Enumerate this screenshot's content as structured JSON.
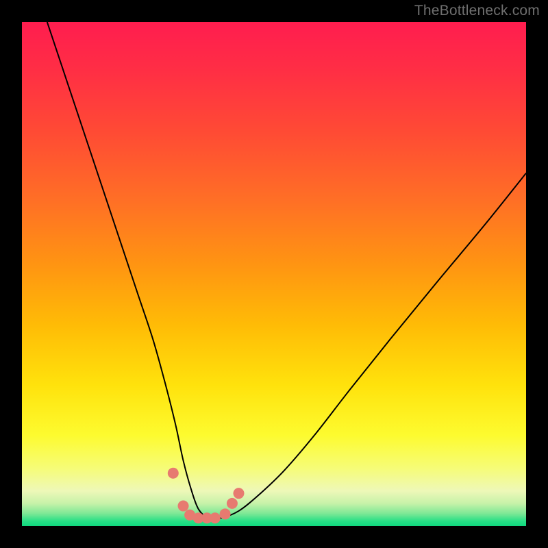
{
  "watermark": "TheBottleneck.com",
  "colors": {
    "frame": "#000000",
    "watermark": "#6f6f6f",
    "curve": "#000000",
    "marker_fill": "#e77a70",
    "marker_stroke": "#b24a42",
    "gradient_stops": [
      {
        "offset": 0.0,
        "color": "#ff1d4f"
      },
      {
        "offset": 0.1,
        "color": "#ff2f44"
      },
      {
        "offset": 0.22,
        "color": "#ff4b34"
      },
      {
        "offset": 0.35,
        "color": "#ff6e26"
      },
      {
        "offset": 0.48,
        "color": "#ff9412"
      },
      {
        "offset": 0.6,
        "color": "#ffbb06"
      },
      {
        "offset": 0.72,
        "color": "#ffe20c"
      },
      {
        "offset": 0.82,
        "color": "#fdfb2f"
      },
      {
        "offset": 0.885,
        "color": "#f6fc77"
      },
      {
        "offset": 0.93,
        "color": "#eef8b8"
      },
      {
        "offset": 0.955,
        "color": "#c7f2a9"
      },
      {
        "offset": 0.975,
        "color": "#7ee896"
      },
      {
        "offset": 0.99,
        "color": "#28df86"
      },
      {
        "offset": 1.0,
        "color": "#0fd97f"
      }
    ]
  },
  "chart_data": {
    "type": "line",
    "title": "",
    "xlabel": "",
    "ylabel": "",
    "xlim": [
      0,
      100
    ],
    "ylim": [
      0,
      100
    ],
    "grid": false,
    "legend": false,
    "series": [
      {
        "name": "bottleneck-curve",
        "x": [
          5,
          8,
          11,
          14,
          17,
          20,
          23,
          26,
          28.5,
          30.5,
          32,
          33.5,
          35,
          37,
          39.5,
          43,
          47,
          52,
          58,
          65,
          73,
          82,
          92,
          100
        ],
        "y": [
          100,
          91,
          82,
          73,
          64,
          55,
          46,
          37,
          28,
          20,
          13,
          7.5,
          3.4,
          1.6,
          1.6,
          3.0,
          6.2,
          11,
          18,
          27,
          37,
          48,
          60,
          70
        ]
      }
    ],
    "markers": {
      "name": "bottleneck-markers",
      "x": [
        30.0,
        32.0,
        33.3,
        35.0,
        36.7,
        38.3,
        40.3,
        41.7,
        43.0
      ],
      "y": [
        10.5,
        4.0,
        2.2,
        1.6,
        1.6,
        1.6,
        2.4,
        4.5,
        6.5
      ]
    }
  }
}
